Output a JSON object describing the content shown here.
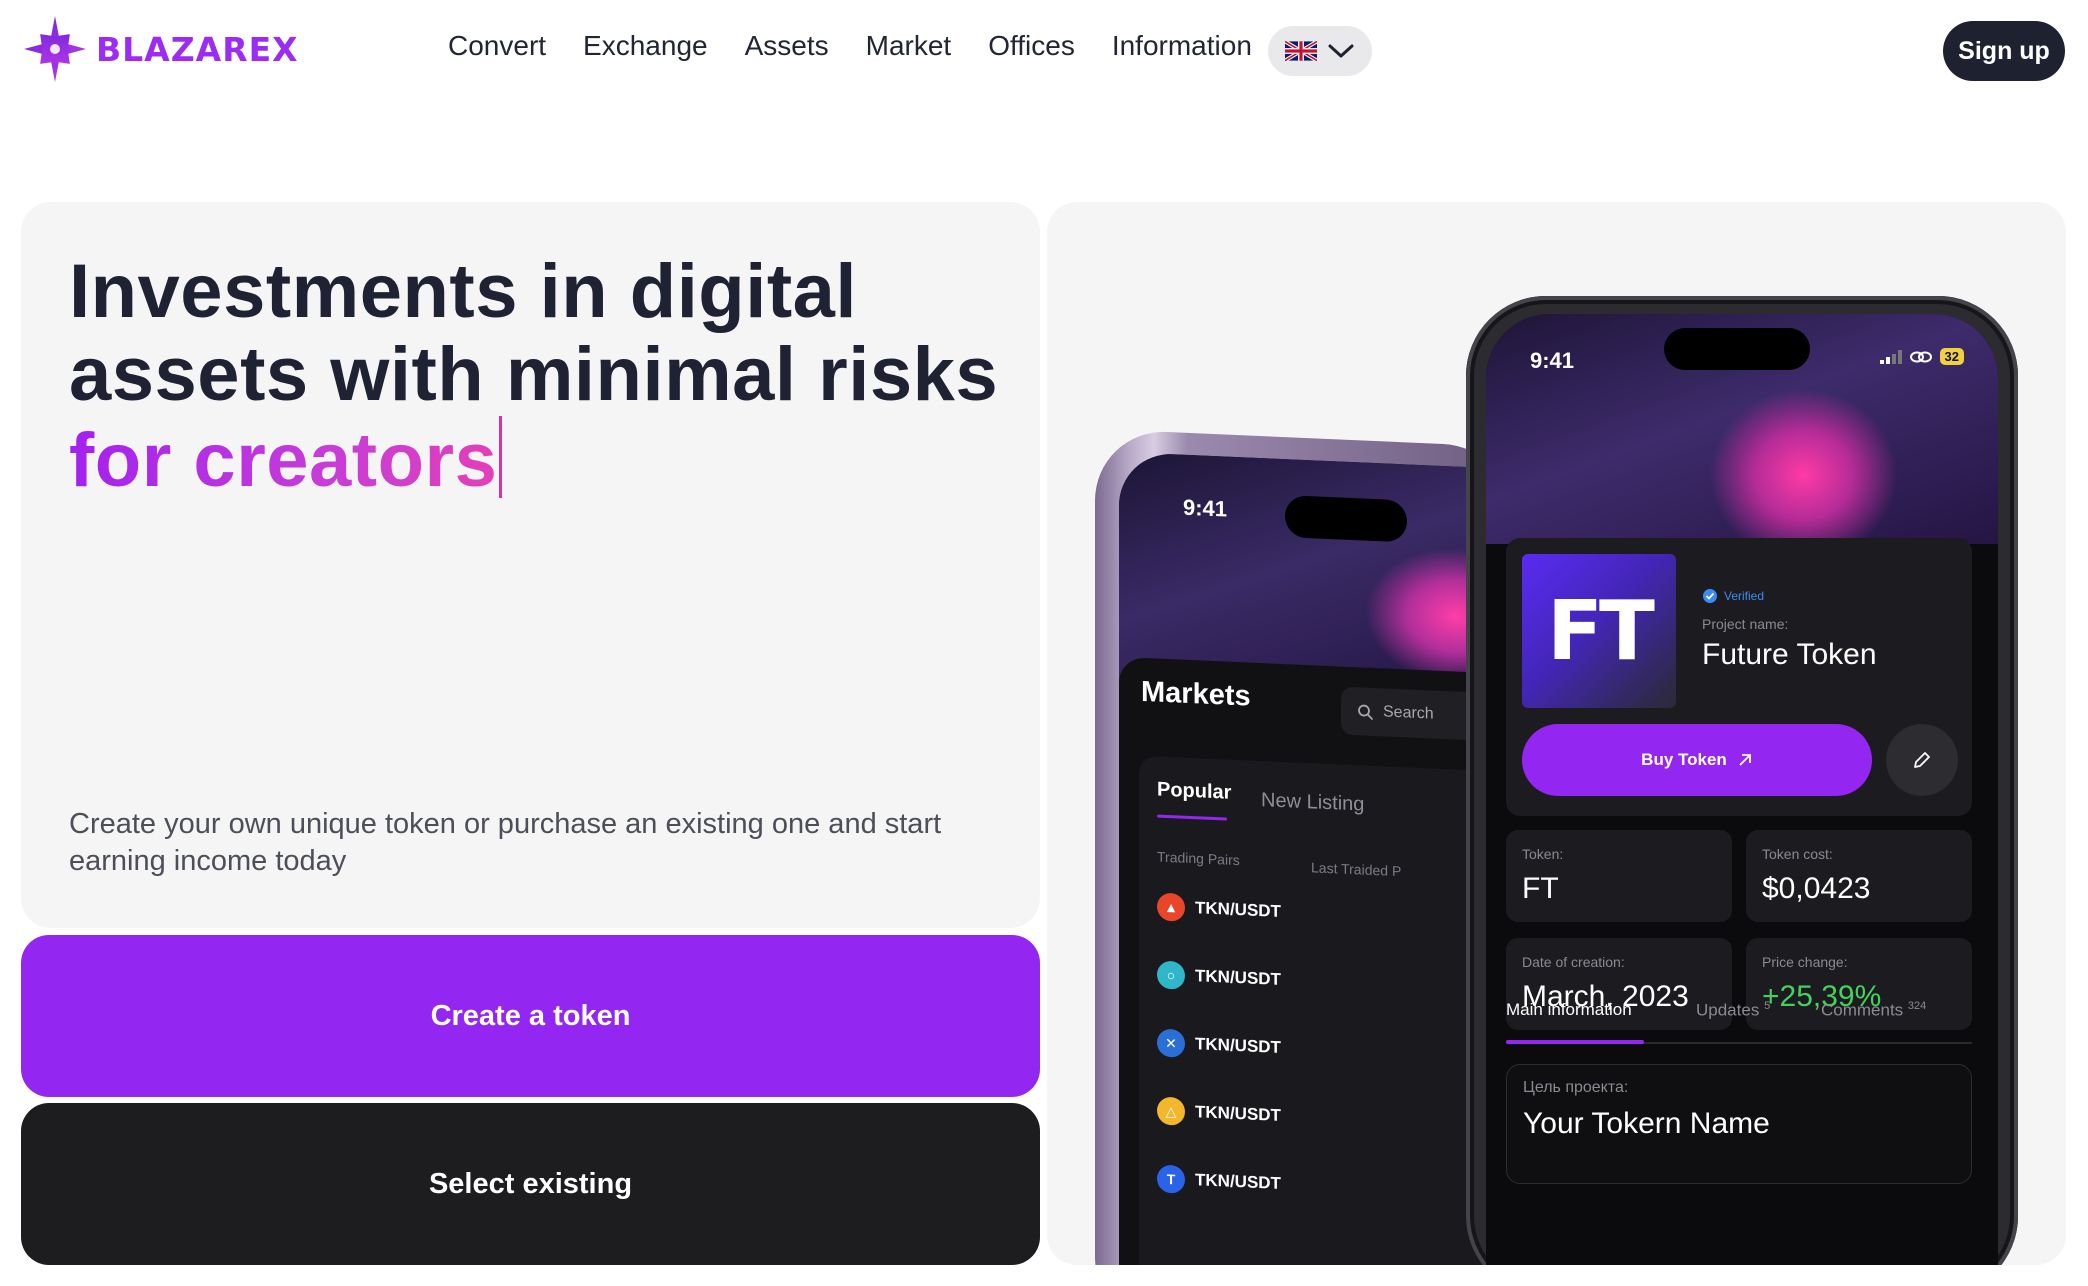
{
  "brand": {
    "name": "BLAZAREX",
    "color": "#9c2cf3"
  },
  "nav": {
    "items": [
      {
        "label": "Convert"
      },
      {
        "label": "Exchange"
      },
      {
        "label": "Assets"
      },
      {
        "label": "Market"
      },
      {
        "label": "Offices"
      },
      {
        "label": "Information"
      }
    ],
    "language": {
      "flag_icon": "uk-flag-icon",
      "chevron_icon": "chevron-down-icon"
    },
    "signup_label": "Sign up"
  },
  "hero": {
    "headline_line1": "Investments in digital",
    "headline_line2": "assets with minimal risks",
    "headline_accent": "for creators",
    "subtitle": "Create your own unique token or purchase an existing one and start earning income today",
    "create_label": "Create a token",
    "select_label": "Select existing"
  },
  "phone_back": {
    "time": "9:41",
    "title": "Markets",
    "search_placeholder": "Search",
    "tabs": [
      "Popular",
      "New Listing"
    ],
    "col_pairs": "Trading Pairs",
    "col_last": "Last Traided P",
    "pairs": [
      {
        "name": "TKN/USDT",
        "icon": "tron-icon",
        "color": "#e8452b"
      },
      {
        "name": "TKN/USDT",
        "icon": "circle-coin-icon",
        "color": "#2fb6c8"
      },
      {
        "name": "TKN/USDT",
        "icon": "xrp-icon",
        "color": "#2a6fd6"
      },
      {
        "name": "TKN/USDT",
        "icon": "triangle-coin-icon",
        "color": "#f2b72a"
      },
      {
        "name": "TKN/USDT",
        "icon": "t-coin-icon",
        "color": "#2a63e8"
      }
    ]
  },
  "phone_front": {
    "time": "9:41",
    "battery": "32",
    "logo_text": "FT",
    "verified": "Verified",
    "project_label": "Project name:",
    "project_name": "Future Token",
    "buy_label": "Buy Token",
    "stats": {
      "token_label": "Token:",
      "token_value": "FT",
      "cost_label": "Token cost:",
      "cost_value": "$0,0423",
      "date_label": "Date of creation:",
      "date_value": "March, 2023",
      "change_label": "Price change:",
      "change_value": "+25,39%"
    },
    "tabs": {
      "main": "Main information",
      "updates": "Updates",
      "updates_count": "5",
      "comments": "Comments",
      "comments_count": "324"
    },
    "goal_label": "Цель проекта:",
    "goal_value": "Your Tokern Name"
  },
  "colors": {
    "accent": "#9426f2",
    "dark": "#1d1d1f",
    "positive": "#44d15d"
  }
}
